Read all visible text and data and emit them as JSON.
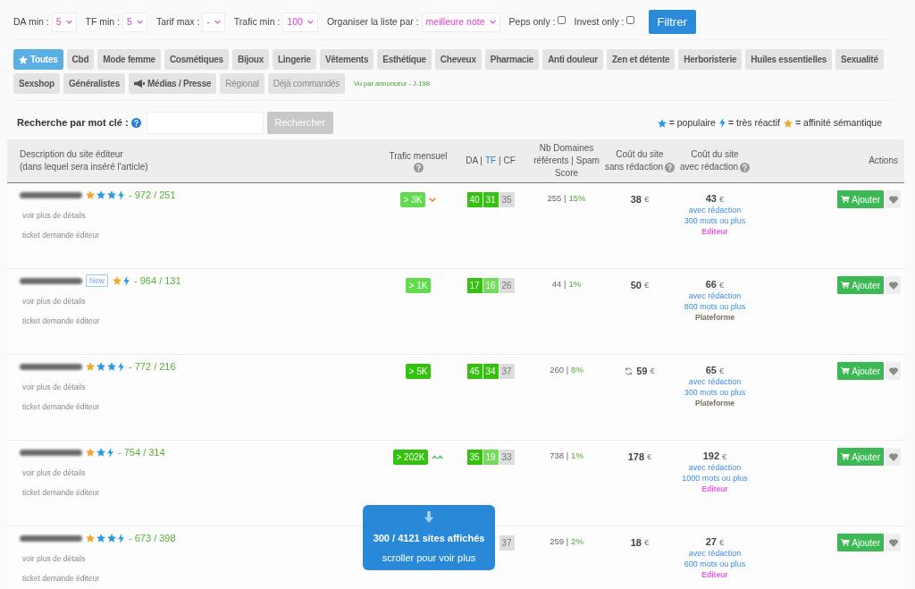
{
  "filters": {
    "selects": [
      {
        "label": "DA min :",
        "value": "5"
      },
      {
        "label": "TF min :",
        "value": "5"
      },
      {
        "label": "Tarif max :",
        "value": "-"
      },
      {
        "label": "Trafic min :",
        "value": "100"
      },
      {
        "label": "Organiser la liste par :",
        "value": "meilleure note"
      }
    ],
    "checkboxes": [
      {
        "label": "Peps only :",
        "checked": false
      },
      {
        "label": "Invest only :",
        "checked": false
      }
    ],
    "submit": "Filtrer"
  },
  "categories": [
    {
      "kind": "all",
      "label": "Toutes",
      "selected": true,
      "disabled": false
    },
    {
      "kind": "plain",
      "label": "Cbd",
      "selected": false,
      "disabled": false
    },
    {
      "kind": "plain",
      "label": "Mode femme",
      "selected": false,
      "disabled": false
    },
    {
      "kind": "plain",
      "label": "Cosmétiques",
      "selected": false,
      "disabled": false
    },
    {
      "kind": "plain",
      "label": "Bijoux",
      "selected": false,
      "disabled": false
    },
    {
      "kind": "plain",
      "label": "Lingerie",
      "selected": false,
      "disabled": false
    },
    {
      "kind": "plain",
      "label": "Vêtements",
      "selected": false,
      "disabled": false
    },
    {
      "kind": "plain",
      "label": "Esthétique",
      "selected": false,
      "disabled": false
    },
    {
      "kind": "plain",
      "label": "Cheveux",
      "selected": false,
      "disabled": false
    },
    {
      "kind": "plain",
      "label": "Pharmacie",
      "selected": false,
      "disabled": false
    },
    {
      "kind": "plain",
      "label": "Anti douleur",
      "selected": false,
      "disabled": false
    },
    {
      "kind": "plain",
      "label": "Zen et détente",
      "selected": false,
      "disabled": false
    },
    {
      "kind": "plain",
      "label": "Herboristerie",
      "selected": false,
      "disabled": false
    },
    {
      "kind": "plain",
      "label": "Huiles essentielles",
      "selected": false,
      "disabled": false
    },
    {
      "kind": "plain",
      "label": "Sexualité",
      "selected": false,
      "disabled": false
    },
    {
      "kind": "plain",
      "label": "Sexshop",
      "selected": false,
      "disabled": false
    },
    {
      "kind": "plain",
      "label": "Généralistes",
      "selected": false,
      "disabled": false
    },
    {
      "kind": "media",
      "label": "Médias / Presse",
      "selected": false,
      "disabled": false
    },
    {
      "kind": "plain",
      "label": "Régional",
      "selected": false,
      "disabled": true
    },
    {
      "kind": "plain",
      "label": "Déjà commandés",
      "selected": false,
      "disabled": true
    }
  ],
  "categories_note": "Vu par annonceur - J-198",
  "search": {
    "label": "Recherche par mot clé :",
    "button": {
      "label": "Rechercher",
      "disabled": true
    }
  },
  "legend": [
    {
      "kind": "popular",
      "label": "= populaire"
    },
    {
      "kind": "reactive",
      "label": "= très réactif"
    },
    {
      "kind": "affinity",
      "label": "= affinité sémantique"
    }
  ],
  "table": {
    "columns": [
      {
        "kind": "description",
        "label": "Description du site éditeur",
        "sublabel": "(dans lequel sera inséré l'article)",
        "help": false
      },
      {
        "kind": "traffic",
        "label": "Trafic mensuel",
        "help": true
      },
      {
        "kind": "scores",
        "parts": [
          {
            "text": "DA |",
            "link": false
          },
          {
            "text": "TF",
            "link": true
          },
          {
            "text": "| CF",
            "link": false
          }
        ],
        "help": false
      },
      {
        "kind": "domains",
        "label": "Nb Domaines référents | Spam Score",
        "help": false
      },
      {
        "kind": "cost",
        "label": "Coût du site",
        "sublabel": "sans rédaction",
        "help": true
      },
      {
        "kind": "cost",
        "label": "Coût du site",
        "sublabel": "avec rédaction",
        "help": true
      },
      {
        "kind": "actions",
        "label": "Actions",
        "help": false
      }
    ],
    "rows": [
      {
        "markers": [
          {
            "kind": "affinity"
          },
          {
            "kind": "popular"
          },
          {
            "kind": "popular"
          },
          {
            "kind": "reactive"
          }
        ],
        "score": "- 972 / 251",
        "links": {
          "details": "voir plus de détails",
          "ticket": "ticket demande éditeur"
        },
        "traffic": {
          "kind": "falling",
          "label": "> 3K",
          "color": "#62da4e"
        },
        "da": {
          "value": "40",
          "color": "#35c20e"
        },
        "tf": {
          "value": "31",
          "color": "#35c20e"
        },
        "cf": "35",
        "domains": "255 |",
        "spam": "15%",
        "cost_without": {
          "kind": "plain",
          "amount": "38",
          "currency": "€"
        },
        "cost_with": {
          "amount": "43",
          "currency": "€",
          "note": "avec rédaction",
          "words": "300 mots ou plus",
          "source": {
            "label": "Editeur",
            "color": "#e45de4"
          }
        },
        "button": "Ajouter"
      },
      {
        "tag": "New",
        "markers": [
          {
            "kind": "affinity"
          },
          {
            "kind": "reactive"
          }
        ],
        "score": "- 964 / 131",
        "links": {
          "details": "voir plus de détails",
          "ticket": "ticket demande éditeur"
        },
        "traffic": {
          "kind": "steady",
          "label": "> 1K",
          "color": "#62da4e"
        },
        "da": {
          "value": "17",
          "color": "#35c20e"
        },
        "tf": {
          "value": "16",
          "color": "#74dc5c"
        },
        "cf": "26",
        "domains": "44 |",
        "spam": "1%",
        "cost_without": {
          "kind": "plain",
          "amount": "50",
          "currency": "€"
        },
        "cost_with": {
          "amount": "66",
          "currency": "€",
          "note": "avec rédaction",
          "words": "800 mots ou plus",
          "source": {
            "label": "Plateforme",
            "color": "#7d6f62"
          }
        },
        "button": "Ajouter"
      },
      {
        "markers": [
          {
            "kind": "affinity"
          },
          {
            "kind": "popular"
          },
          {
            "kind": "popular"
          },
          {
            "kind": "reactive"
          }
        ],
        "score": "- 772 / 216",
        "links": {
          "details": "voir plus de détails",
          "ticket": "ticket demande éditeur"
        },
        "traffic": {
          "kind": "steady",
          "label": "> 5K",
          "color": "#35c20e"
        },
        "da": {
          "value": "45",
          "color": "#35c20e"
        },
        "tf": {
          "value": "34",
          "color": "#35c20e"
        },
        "cf": "37",
        "domains": "260 |",
        "spam": "8%",
        "cost_without": {
          "kind": "renewal",
          "amount": "59",
          "currency": "€"
        },
        "cost_with": {
          "amount": "65",
          "currency": "€",
          "note": "avec rédaction",
          "words": "300 mots ou plus",
          "source": {
            "label": "Plateforme",
            "color": "#7d6f62"
          }
        },
        "button": "Ajouter"
      },
      {
        "markers": [
          {
            "kind": "affinity"
          },
          {
            "kind": "popular"
          },
          {
            "kind": "reactive"
          }
        ],
        "score": "- 754 / 314",
        "links": {
          "details": "voir plus de détails",
          "ticket": "ticket demande éditeur"
        },
        "traffic": {
          "kind": "rising",
          "label": "> 202K",
          "color": "#35c20e"
        },
        "da": {
          "value": "35",
          "color": "#35c20e"
        },
        "tf": {
          "value": "19",
          "color": "#74dc5c"
        },
        "cf": "33",
        "domains": "738 |",
        "spam": "1%",
        "cost_without": {
          "kind": "plain",
          "amount": "178",
          "currency": "€"
        },
        "cost_with": {
          "amount": "192",
          "currency": "€",
          "note": "avec rédaction",
          "words": "1000 mots ou plus",
          "source": {
            "label": "Editeur",
            "color": "#e45de4"
          }
        },
        "button": "Ajouter"
      },
      {
        "markers": [
          {
            "kind": "affinity"
          },
          {
            "kind": "popular"
          },
          {
            "kind": "popular"
          },
          {
            "kind": "reactive"
          }
        ],
        "score": "- 673 / 398",
        "links": {
          "details": "voir plus de détails",
          "ticket": "ticket demande éditeur"
        },
        "cf": "37",
        "domains": "259 |",
        "spam": "2%",
        "cost_without": {
          "kind": "plain",
          "amount": "18",
          "currency": "€"
        },
        "cost_with": {
          "amount": "27",
          "currency": "€",
          "note": "avec rédaction",
          "words": "600 mots ou plus",
          "source": {
            "label": "Editeur",
            "color": "#e45de4"
          }
        },
        "button": "Ajouter"
      }
    ]
  },
  "scroll_notice": {
    "count": "300 / 4121 sites affichés",
    "hint": "scroller pour voir plus"
  }
}
